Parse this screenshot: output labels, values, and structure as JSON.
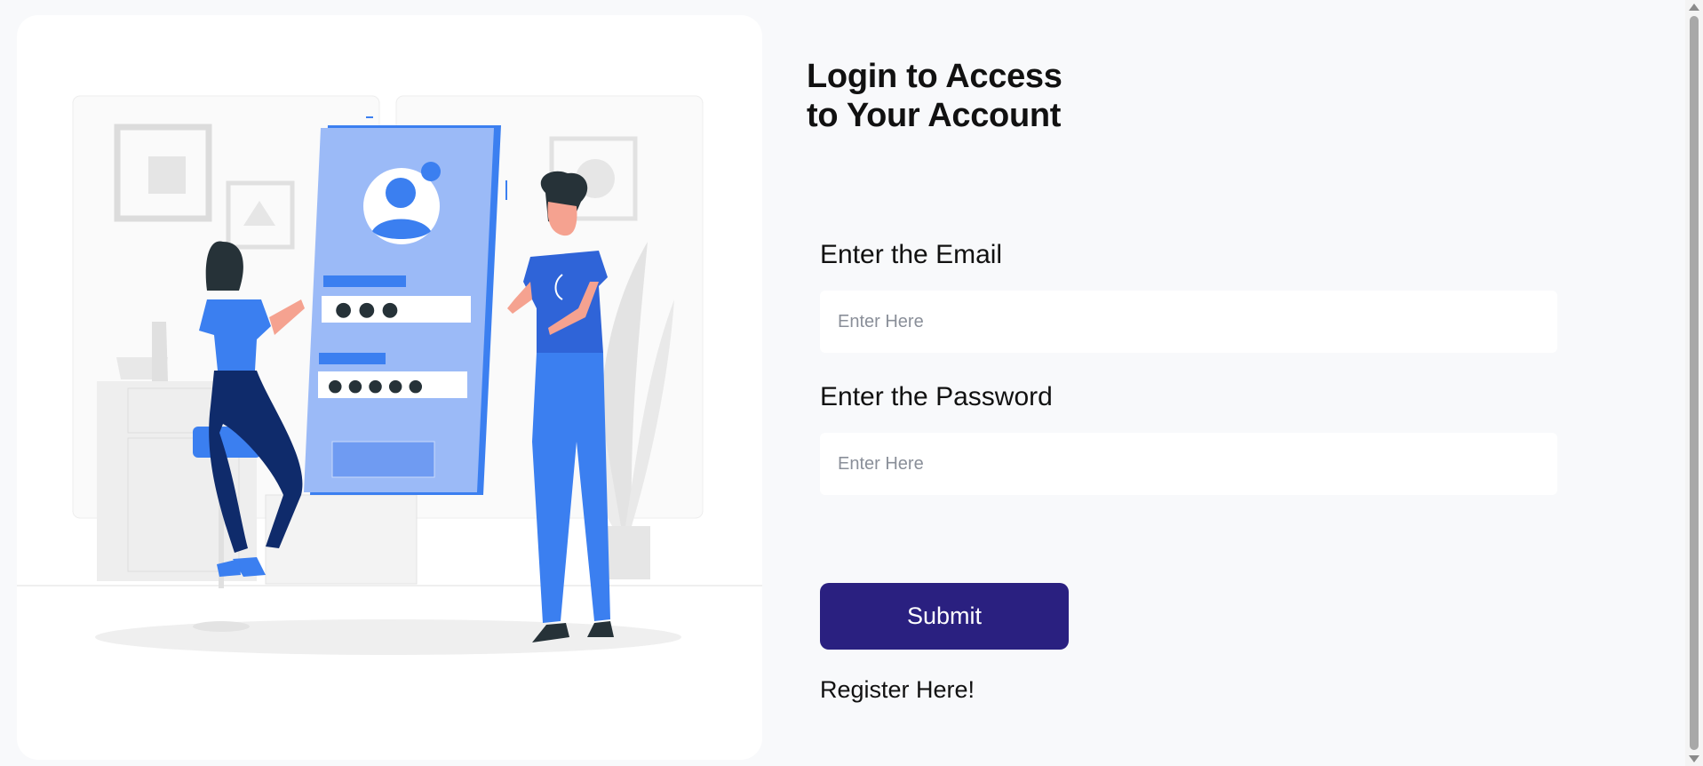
{
  "illustration": {
    "alt": "login illustration",
    "mock_phone_dots": [
      "● ● ●",
      "● ● ● ● ●"
    ]
  },
  "form": {
    "title_line1": "Login to Access",
    "title_line2": "to Your Account",
    "email_label": "Enter the Email",
    "email_placeholder": "Enter Here",
    "email_value": "",
    "password_label": "Enter the Password",
    "password_placeholder": "Enter Here",
    "password_value": "",
    "submit_label": "Submit",
    "register_label": "Register Here!"
  },
  "colors": {
    "primary": "#2a2080",
    "accent_blue": "#3b7ff0",
    "page_bg": "#f8f9fb"
  }
}
